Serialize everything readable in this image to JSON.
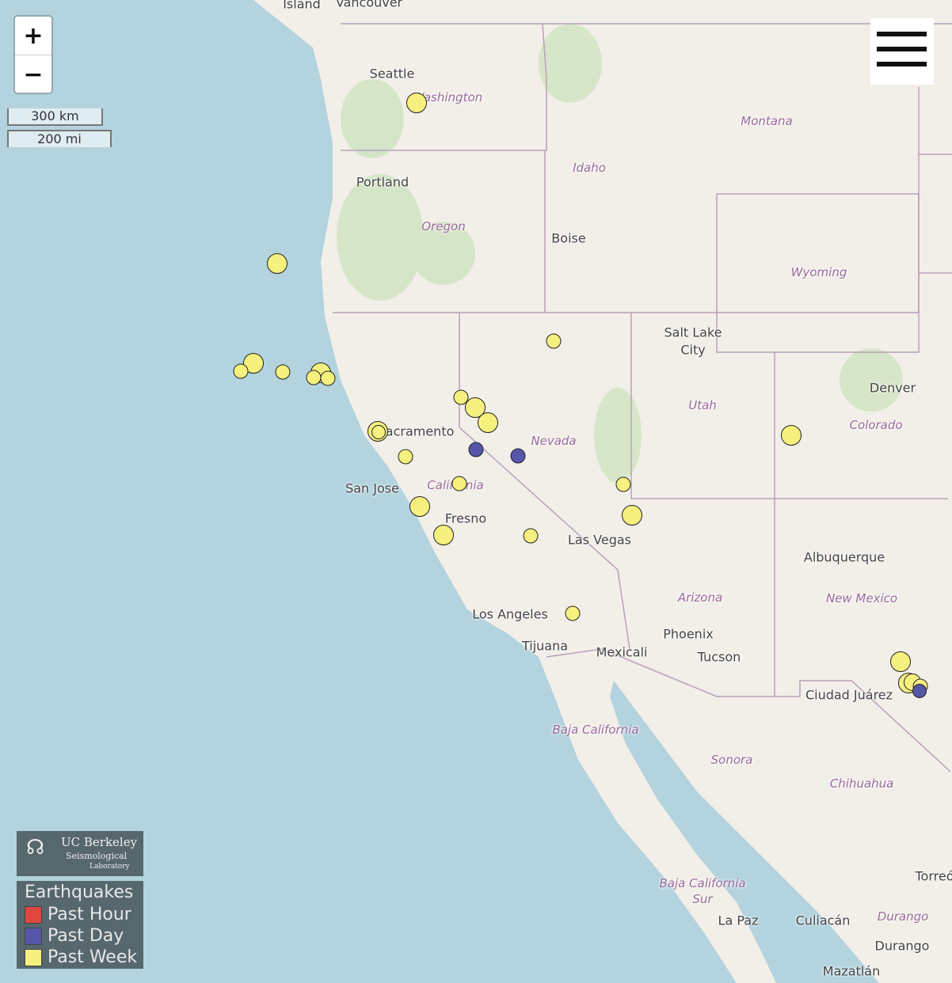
{
  "map": {
    "cities": [
      "Vancouver",
      "Island",
      "Seattle",
      "Portland",
      "Boise",
      "Salt Lake",
      "City",
      "Denver",
      "Sacramento",
      "San Jose",
      "Fresno",
      "Las Vegas",
      "Albuquerque",
      "Los Angeles",
      "Tijuana",
      "Mexicali",
      "Phoenix",
      "Tucson",
      "Ciudad Juárez",
      "La Paz",
      "Culiacán",
      "Durango",
      "Mazatlán",
      "Torreó"
    ],
    "regions": [
      "Washington",
      "Montana",
      "Idaho",
      "Oregon",
      "Wyoming",
      "Utah",
      "Colorado",
      "Nevada",
      "California",
      "Arizona",
      "New Mexico",
      "Baja California",
      "Sonora",
      "Chihuahua",
      "Baja California",
      "Sur",
      "Durango"
    ],
    "colors": {
      "water": "#b3d3de",
      "land": "#f2efe9",
      "past_hour": "#e0473f",
      "past_day": "#5656a8",
      "past_week": "#f6f07e"
    }
  },
  "quakes": [
    "week",
    "week",
    "week",
    "week",
    "week",
    "week",
    "week",
    "week",
    "week",
    "week",
    "week",
    "week",
    "week",
    "week",
    "week",
    "day",
    "day",
    "week",
    "week",
    "week",
    "week",
    "week",
    "week",
    "week",
    "week",
    "week",
    "week",
    "week",
    "week",
    "day"
  ],
  "controls": {
    "zoom_in": "+",
    "zoom_out": "−",
    "scale_km": "300 km",
    "scale_mi": "200 mi",
    "menu_icon": "hamburger-icon"
  },
  "logo": {
    "line1": "UC Berkeley",
    "line2": "Seismological",
    "line3": "Laboratory"
  },
  "legend": {
    "title": "Earthquakes",
    "items": [
      {
        "label": "Past Hour",
        "key": "past_hour"
      },
      {
        "label": "Past Day",
        "key": "past_day"
      },
      {
        "label": "Past Week",
        "key": "past_week"
      }
    ]
  }
}
